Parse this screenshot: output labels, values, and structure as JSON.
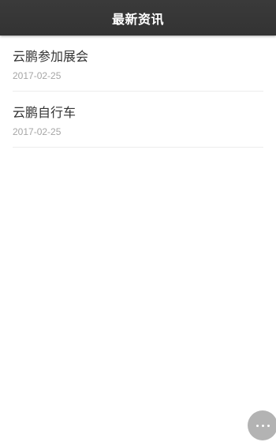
{
  "header": {
    "title": "最新资讯"
  },
  "news": [
    {
      "title": "云鹏参加展会",
      "date": "2017-02-25"
    },
    {
      "title": "云鹏自行车",
      "date": "2017-02-25"
    }
  ],
  "fab": {
    "icon": "more-dots-icon"
  }
}
